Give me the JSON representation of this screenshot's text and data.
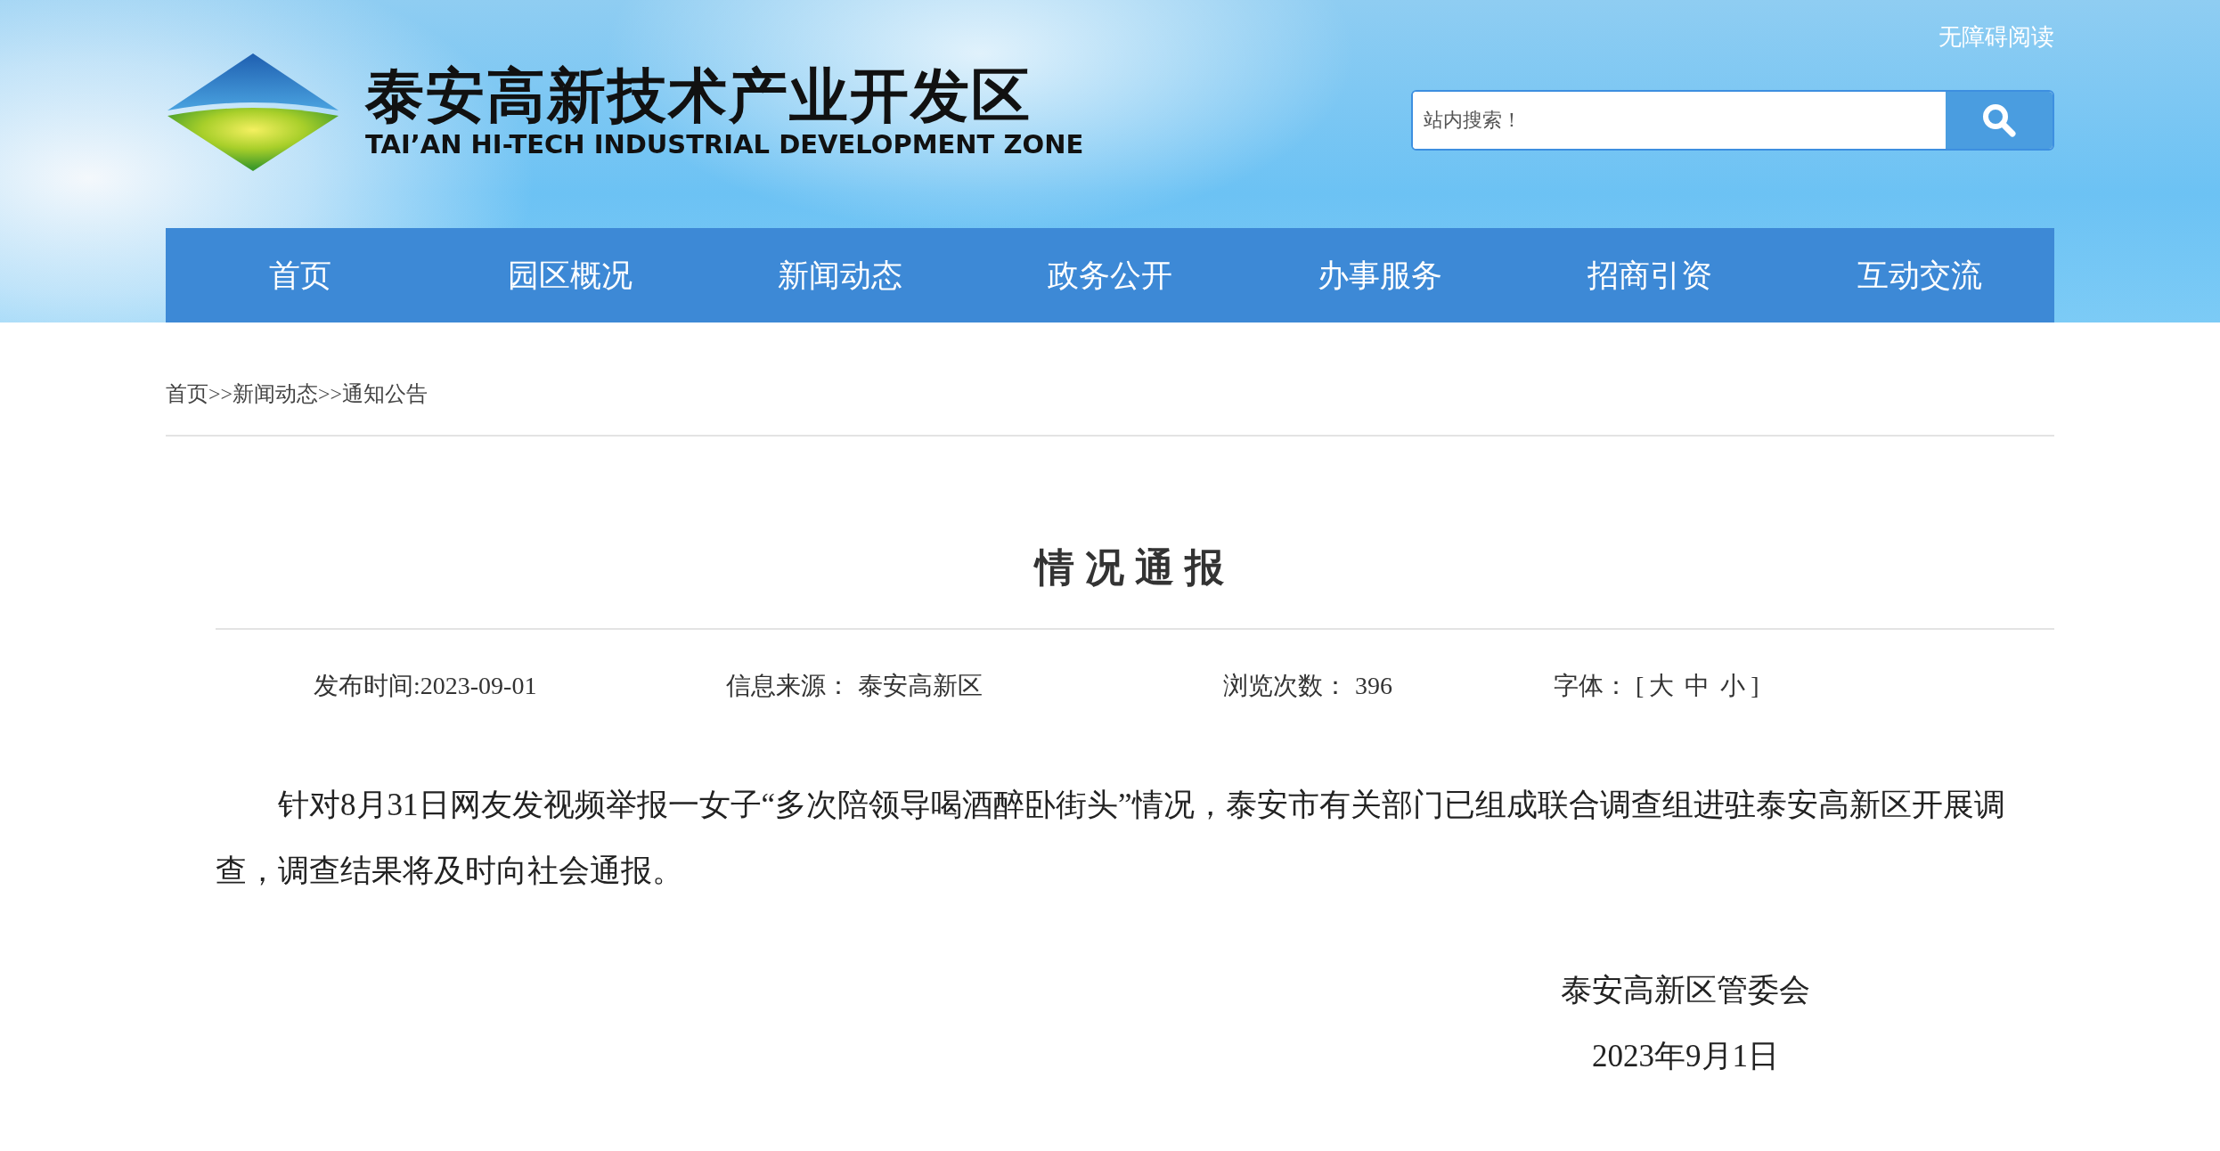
{
  "header": {
    "logo": {
      "title": "泰安高新技术产业开发区",
      "subtitle": "TAI’AN HI-TECH INDUSTRIAL DEVELOPMENT ZONE"
    },
    "accessibility_link": "无障碍阅读",
    "search": {
      "placeholder": "站内搜索！"
    }
  },
  "nav": [
    {
      "label": "首页"
    },
    {
      "label": "园区概况"
    },
    {
      "label": "新闻动态"
    },
    {
      "label": "政务公开"
    },
    {
      "label": "办事服务"
    },
    {
      "label": "招商引资"
    },
    {
      "label": "互动交流"
    }
  ],
  "breadcrumb": {
    "items": [
      "首页",
      "新闻动态",
      "通知公告"
    ],
    "separators": [
      ">>",
      ">>"
    ]
  },
  "article": {
    "title": "情况通报",
    "meta": {
      "published": "发布时间:2023-09-01",
      "source_label": "信息来源：",
      "source": "泰安高新区",
      "views_label": "浏览次数：",
      "views": "396",
      "font_label": "字体：",
      "font_open": "[",
      "font_sizes": [
        "大",
        "中",
        "小"
      ],
      "font_close": "]"
    },
    "body": "针对8月31日网友发视频举报一女子“多次陪领导喝酒醉卧街头”情况，泰安市有关部门已组成联合调查组进驻泰安高新区开展调查，调查结果将及时向社会通报。",
    "signature": "泰安高新区管委会",
    "date": "2023年9月1日"
  }
}
